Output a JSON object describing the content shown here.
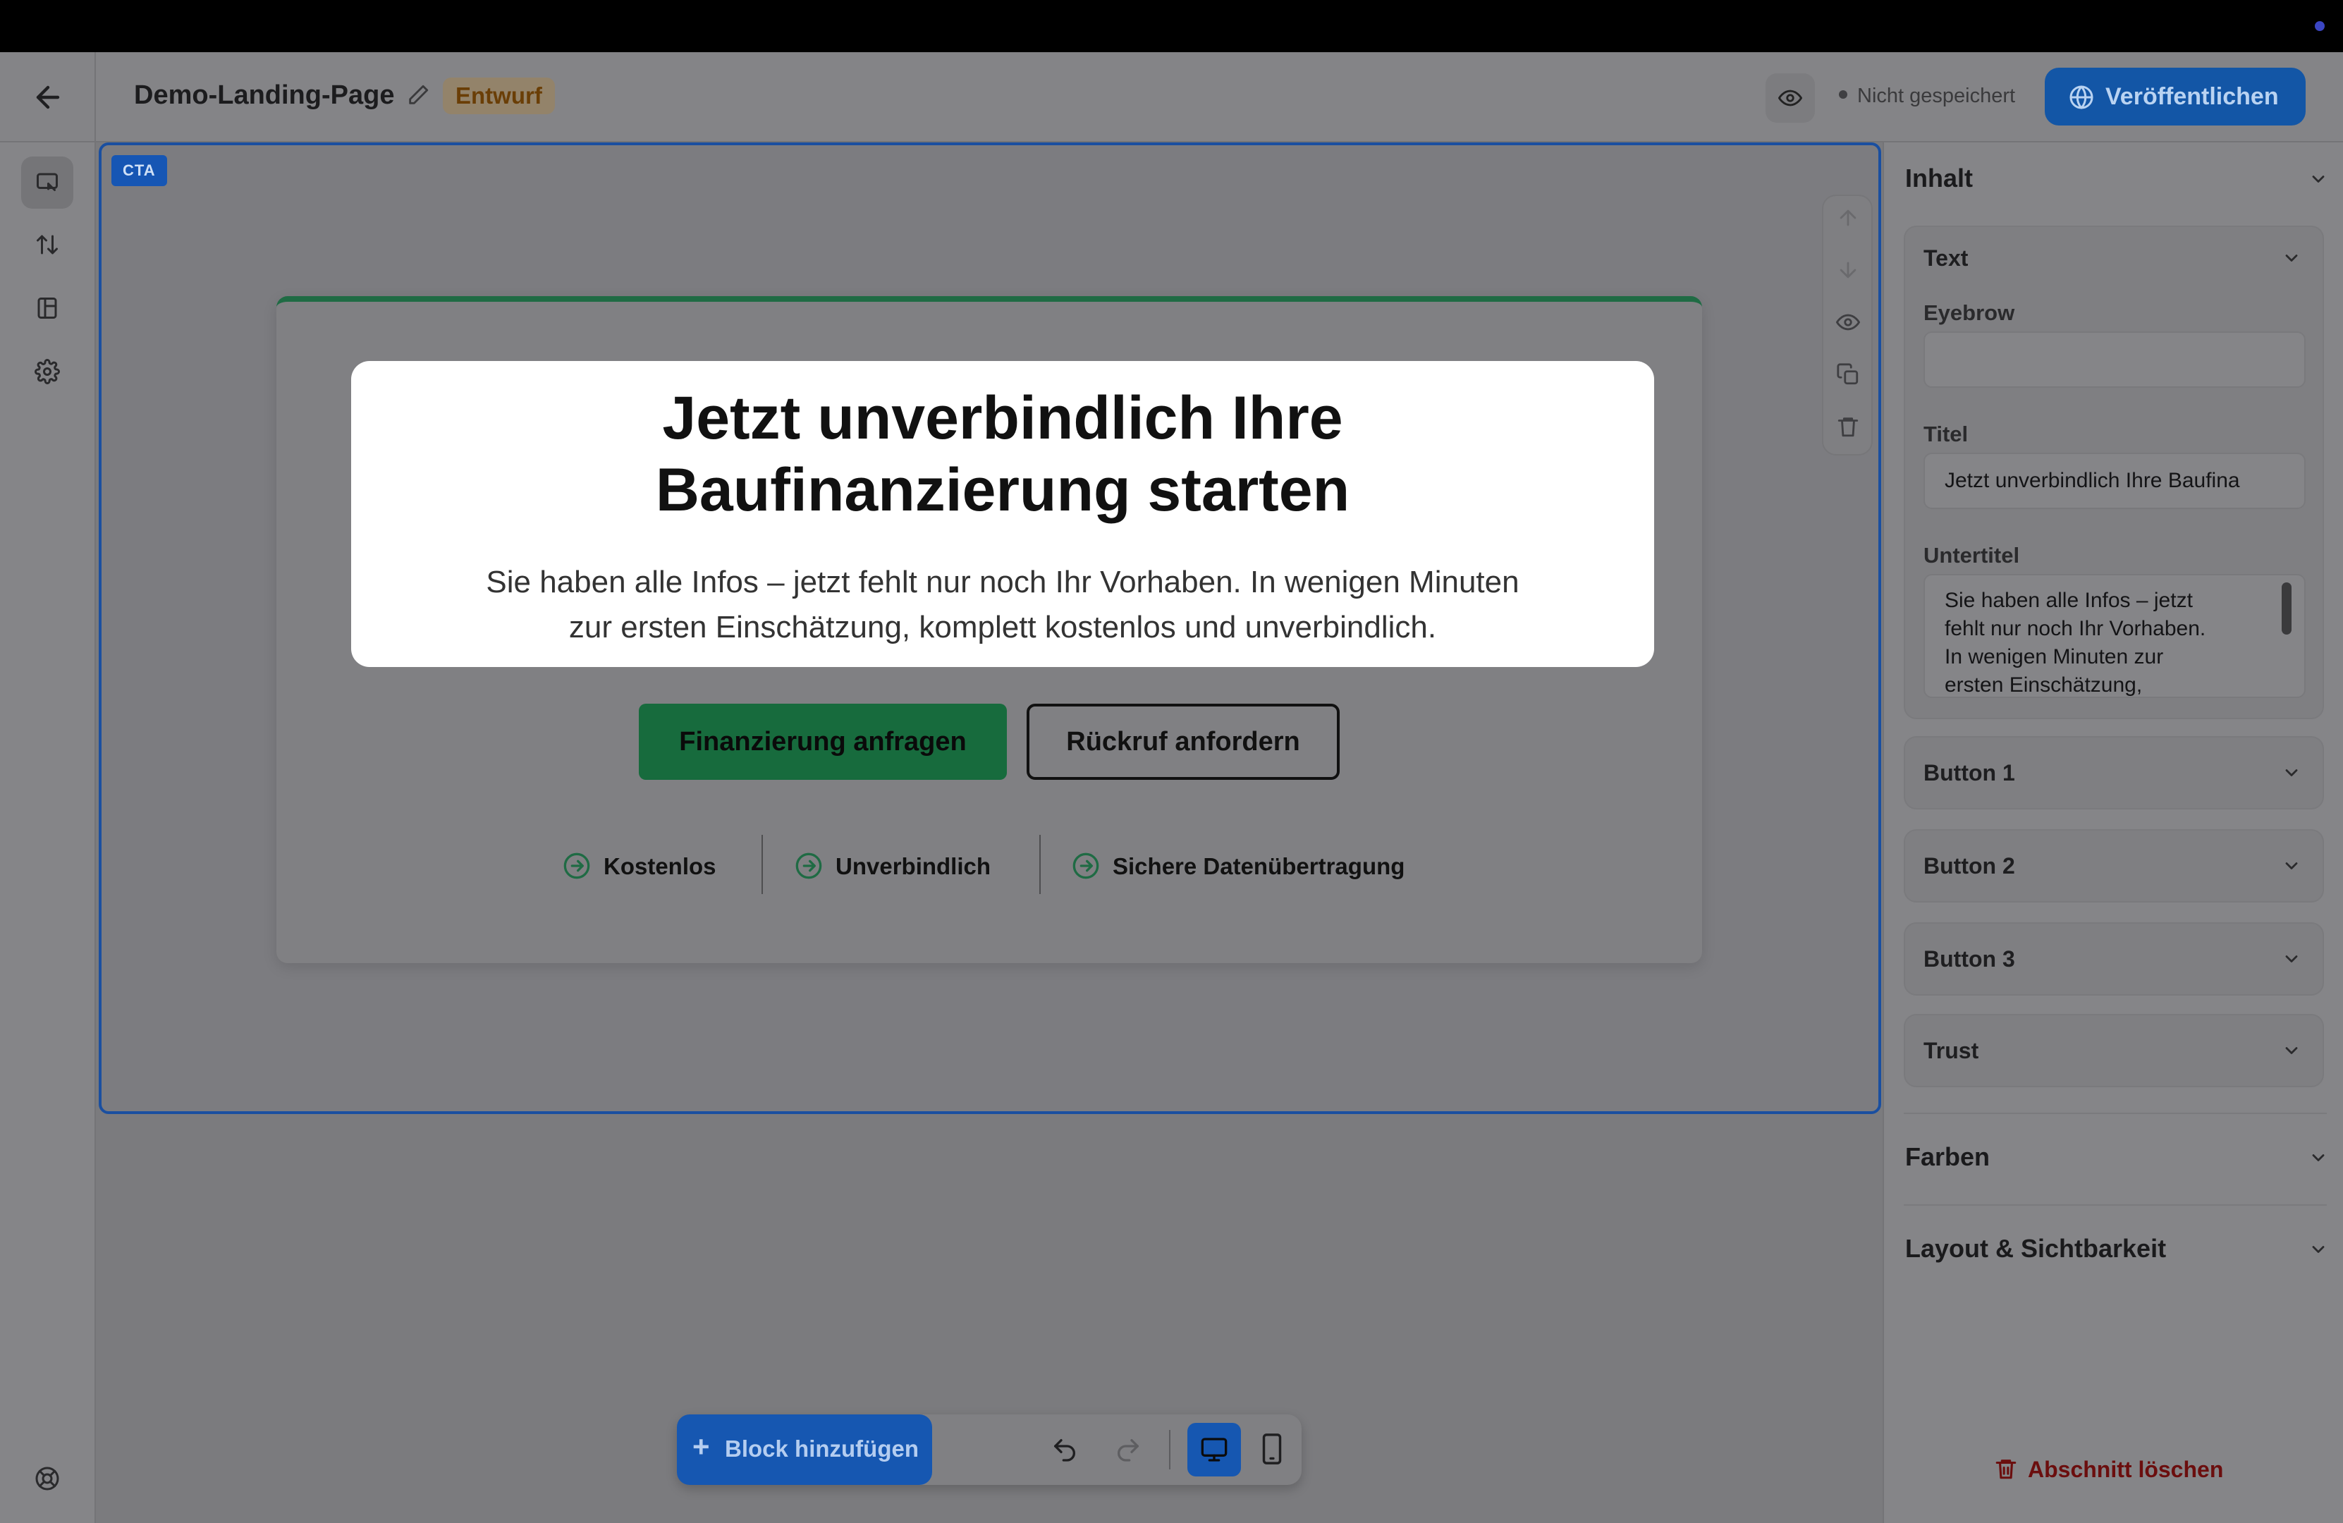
{
  "header": {
    "page_title": "Demo-Landing-Page",
    "status_badge": "Entwurf",
    "save_status": "Nicht gespeichert",
    "publish_label": "Veröffentlichen"
  },
  "section": {
    "tag": "CTA",
    "title_lines": [
      "Jetzt unverbindlich Ihre",
      "Baufinanzierung starten"
    ],
    "subtitle_lines": [
      "Sie haben alle Infos – jetzt fehlt nur noch Ihr Vorhaben. In wenigen Minuten",
      "zur ersten Einschätzung, komplett kostenlos und unverbindlich."
    ],
    "button_primary": "Finanzierung anfragen",
    "button_secondary": "Rückruf anfordern",
    "trust_items": [
      "Kostenlos",
      "Unverbindlich",
      "Sichere Datenübertragung"
    ]
  },
  "toolbar": {
    "add_block": "Block hinzufügen"
  },
  "panel": {
    "inhalt": "Inhalt",
    "text_group": "Text",
    "eyebrow_label": "Eyebrow",
    "eyebrow_value": "",
    "title_label": "Titel",
    "title_value": "Jetzt unverbindlich Ihre Baufina",
    "subtitle_label": "Untertitel",
    "subtitle_lines": [
      "Sie haben alle Infos – jetzt",
      "fehlt nur noch Ihr Vorhaben.",
      "In wenigen Minuten zur",
      "ersten Einschätzung,"
    ],
    "button1": "Button 1",
    "button2": "Button 2",
    "button3": "Button 3",
    "trust": "Trust",
    "farben": "Farben",
    "layout": "Layout & Sichtbarkeit",
    "delete_section": "Abschnitt löschen"
  },
  "colors": {
    "primary_blue": "#1356a6",
    "accent_green": "#176b3d",
    "draft_badge": "#93836a",
    "delete_red": "#6b0e0e"
  }
}
